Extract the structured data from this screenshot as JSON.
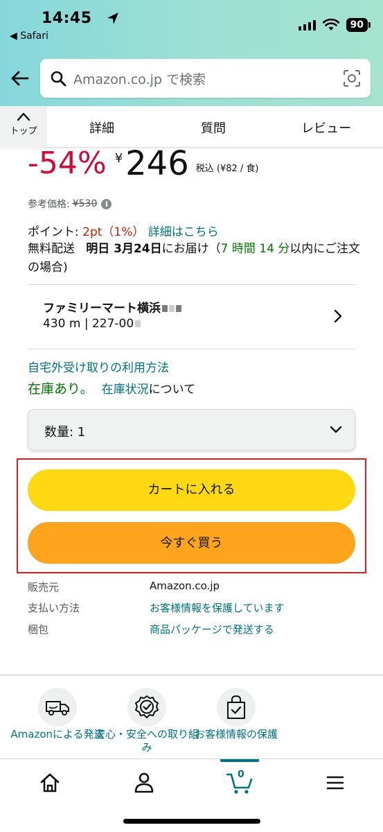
{
  "status_bar": {
    "time": "14:45",
    "back_app": "◀ Safari",
    "battery": "90"
  },
  "search": {
    "placeholder": "Amazon.co.jp で検索"
  },
  "tabs": {
    "top_label": "トップ",
    "items": [
      "詳細",
      "質問",
      "レビュー"
    ]
  },
  "price": {
    "discount": "-54%",
    "currency": "¥",
    "amount": "246",
    "unit_note": "税込 (¥82 / 食)",
    "reference_label": "参考価格:",
    "reference_price": "¥530"
  },
  "points": {
    "label": "ポイント:",
    "value": "2pt（1%）",
    "link": "詳細はこちら"
  },
  "delivery": {
    "prefix": "無料配送",
    "date": "明日 3月24日",
    "suffix": "にお届け（",
    "countdown": "7 時間 14 分",
    "tail": "以内にご注文の場合)"
  },
  "store": {
    "name": "ファミリーマート横浜",
    "address": "430 m | 227-00"
  },
  "pickup_link": "自宅外受け取りの利用方法",
  "stock": {
    "status": "在庫あり。",
    "link": "在庫状況",
    "suffix": "について"
  },
  "quantity": {
    "label": "数量: 1"
  },
  "buttons": {
    "cart": "カートに入れる",
    "buy_now": "今すぐ買う"
  },
  "seller": [
    {
      "label": "販売元",
      "value": "Amazon.co.jp"
    },
    {
      "label": "支払い方法",
      "value": "お客様情報を保護しています"
    },
    {
      "label": "梱包",
      "value": "商品パッケージで発送する"
    }
  ],
  "assurances": [
    {
      "label": "Amazonによる発送",
      "icon": "truck-icon"
    },
    {
      "label": "安心・安全への取り組み",
      "icon": "badge-check-icon"
    },
    {
      "label": "お客様情報の保護",
      "icon": "bag-check-icon"
    }
  ],
  "bottom_nav": {
    "cart_count": "0"
  },
  "colors": {
    "buy_yellow": "#ffd814",
    "buy_orange": "#ffa41c",
    "discount_red": "#cc0c39",
    "link_teal": "#007185",
    "stock_green": "#007600"
  }
}
